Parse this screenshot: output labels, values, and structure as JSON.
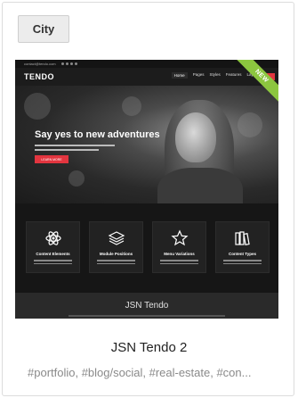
{
  "category_button": {
    "label": "City"
  },
  "preview": {
    "topbar": {
      "email": "contact@tendo.com"
    },
    "logo": "TENDO",
    "menu": [
      "Home",
      "Pages",
      "Styles",
      "Features",
      "Layout"
    ],
    "ribbon": "NEW",
    "hero_title": "Say yes to new adventures",
    "hero_button": "LEARN MORE",
    "features": [
      {
        "title": "Content Elements",
        "icon": "atom-icon"
      },
      {
        "title": "Module Positions",
        "icon": "layers-icon"
      },
      {
        "title": "Menu Variations",
        "icon": "star-icon"
      },
      {
        "title": "Content Types",
        "icon": "books-icon"
      }
    ],
    "footer_title": "JSN Tendo"
  },
  "card": {
    "title": "JSN Tendo 2",
    "tags": "#portfolio, #blog/social, #real-estate, #con..."
  }
}
